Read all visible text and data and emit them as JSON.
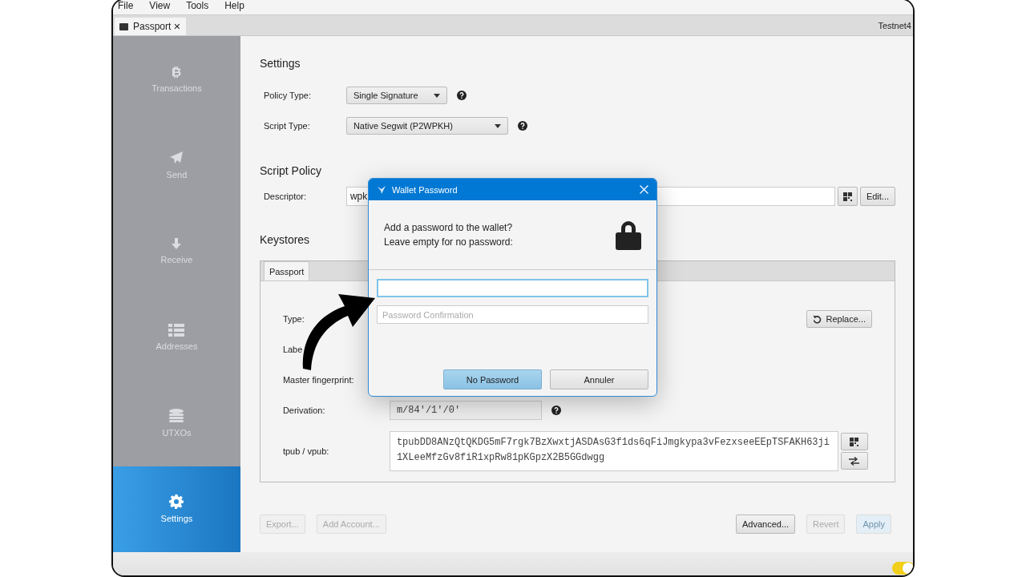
{
  "menu": [
    "File",
    "View",
    "Tools",
    "Help"
  ],
  "tabs": [
    {
      "label": "Passport",
      "close": "✕",
      "selected": true
    }
  ],
  "network": "Testnet4",
  "sidebar": [
    {
      "label": "Transactions",
      "selected": false
    },
    {
      "label": "Send",
      "selected": false
    },
    {
      "label": "Receive",
      "selected": false
    },
    {
      "label": "Addresses",
      "selected": false
    },
    {
      "label": "UTXOs",
      "selected": false
    },
    {
      "label": "Settings",
      "selected": true
    }
  ],
  "settings": {
    "title": "Settings",
    "policy_type": {
      "label": "Policy Type:",
      "value": "Single Signature"
    },
    "script_type": {
      "label": "Script Type:",
      "value": "Native Segwit (P2WPKH)"
    }
  },
  "script_policy": {
    "title": "Script Policy",
    "descriptor_label": "Descriptor:",
    "descriptor_value": "wpk",
    "edit_button": "Edit..."
  },
  "keystores": {
    "title": "Keystores",
    "tabs": [
      {
        "label": "Passport",
        "selected": true
      }
    ],
    "type_label": "Type:",
    "replace_button": "Replace...",
    "label_label": "Labe",
    "fingerprint_label": "Master fingerprint:",
    "derivation_label": "Derivation:",
    "derivation_value": "m/84'/1'/0'",
    "xpub_label": "tpub / vpub:",
    "xpub_value": "tpubDD8ANzQtQKDG5mF7rgk7BzXwxtjASDAsG3f1ds6qFiJmgkypa3vFezxseeEEpTSFAKH63ji1XLeeMfzGv8fiR1xpRw81pKGpzX2B5GGdwgg"
  },
  "buttons_left": [
    {
      "label": "Export...",
      "disabled": true
    },
    {
      "label": "Add Account...",
      "disabled": true
    }
  ],
  "buttons_right": [
    {
      "label": "Advanced...",
      "disabled": false,
      "kind": "plain"
    },
    {
      "label": "Revert",
      "disabled": true,
      "kind": "plain"
    },
    {
      "label": "Apply",
      "disabled": true,
      "kind": "default"
    }
  ],
  "dialog": {
    "title": "Wallet Password",
    "message": [
      "Add a password to the wallet?",
      "Leave empty for no password:"
    ],
    "confirmation": {
      "placeholder": "Password Confirmation"
    },
    "buttons": [
      {
        "label": "No Password",
        "kind": "default"
      },
      {
        "label": "Annuler",
        "kind": "plain"
      }
    ]
  },
  "status": {
    "toggle_on": true
  }
}
